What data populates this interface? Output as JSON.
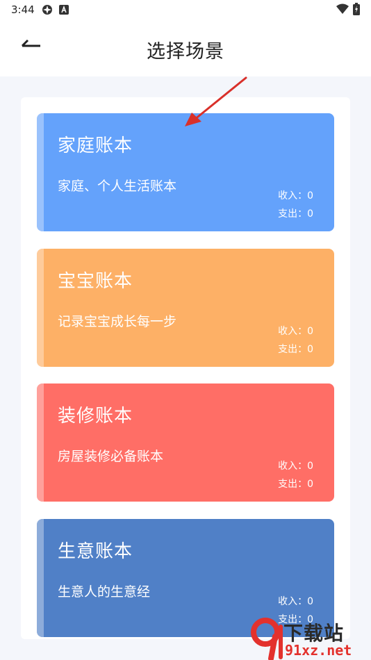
{
  "status_bar": {
    "time": "3:44"
  },
  "header": {
    "title": "选择场景"
  },
  "colors": {
    "family": "#64a2fb",
    "baby": "#fdb066",
    "renovation": "#ff6e66",
    "business": "#5080c7"
  },
  "cards": [
    {
      "title": "家庭账本",
      "subtitle": "家庭、个人生活账本",
      "income": "收入：0",
      "expense": "支出：0"
    },
    {
      "title": "宝宝账本",
      "subtitle": "记录宝宝成长每一步",
      "income": "收入：0",
      "expense": "支出：0"
    },
    {
      "title": "装修账本",
      "subtitle": "房屋装修必备账本",
      "income": "收入：0",
      "expense": "支出：0"
    },
    {
      "title": "生意账本",
      "subtitle": "生意人的生意经",
      "income": "收入：0",
      "expense": "支出：0"
    }
  ],
  "watermark": {
    "brand_top": "下载站",
    "brand_bottom": "91xz.net"
  }
}
